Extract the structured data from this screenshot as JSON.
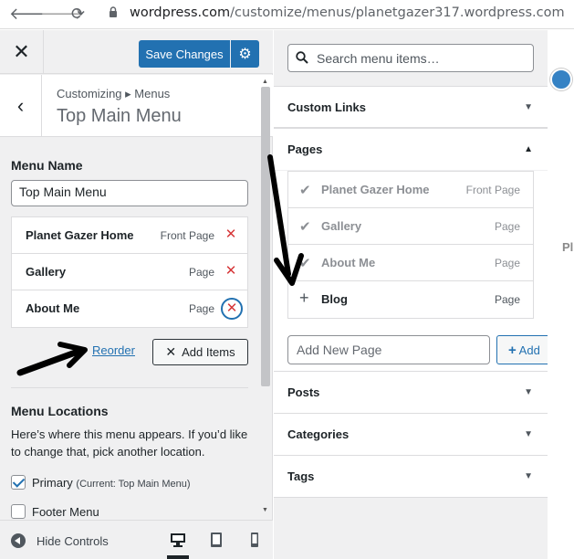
{
  "browser": {
    "url_host": "wordpress.com",
    "url_path": "/customize/menus/planetgazer317.wordpress.com"
  },
  "header": {
    "close_glyph": "✕",
    "save_label": "Save Changes",
    "gear_glyph": "⚙"
  },
  "title": {
    "back_glyph": "‹",
    "breadcrumb": "Customizing ▸ Menus",
    "title": "Top Main Menu"
  },
  "menu": {
    "name_label": "Menu Name",
    "name_value": "Top Main Menu",
    "items": [
      {
        "title": "Planet Gazer Home",
        "type": "Front Page"
      },
      {
        "title": "Gallery",
        "type": "Page"
      },
      {
        "title": "About Me",
        "type": "Page"
      }
    ],
    "remove_glyph": "✕",
    "reorder_label": "Reorder",
    "add_items_label": "Add Items",
    "locations_label": "Menu Locations",
    "locations_desc": "Here’s where this menu appears. If you’d like to change that, pick another location.",
    "location_primary": "Primary",
    "location_primary_current": "(Current: Top Main Menu)",
    "location_primary_checked": true,
    "location_footer": "Footer Menu",
    "location_footer_checked": false
  },
  "footer": {
    "hide_controls_label": "Hide Controls",
    "devices": [
      "desktop-icon",
      "tablet-icon",
      "mobile-icon"
    ],
    "active_device": "desktop"
  },
  "add_panel": {
    "search_placeholder": "Search menu items…",
    "sections": [
      {
        "label": "Custom Links",
        "expanded": false
      },
      {
        "label": "Pages",
        "expanded": true
      },
      {
        "label": "Posts",
        "expanded": false
      },
      {
        "label": "Categories",
        "expanded": false
      },
      {
        "label": "Tags",
        "expanded": false
      }
    ],
    "pages": [
      {
        "title": "Planet Gazer Home",
        "type": "Front Page",
        "added": true
      },
      {
        "title": "Gallery",
        "type": "Page",
        "added": true
      },
      {
        "title": "About Me",
        "type": "Page",
        "added": true
      },
      {
        "title": "Blog",
        "type": "Page",
        "added": false
      }
    ],
    "new_page_placeholder": "Add New Page",
    "add_button_label": "Add",
    "check_glyph": "✔",
    "plus_glyph": "+"
  },
  "preview": {
    "partial_text": "Pl"
  },
  "colors": {
    "primary": "#2271b1",
    "danger": "#d63638",
    "panel_bg": "#f0f0f1"
  }
}
